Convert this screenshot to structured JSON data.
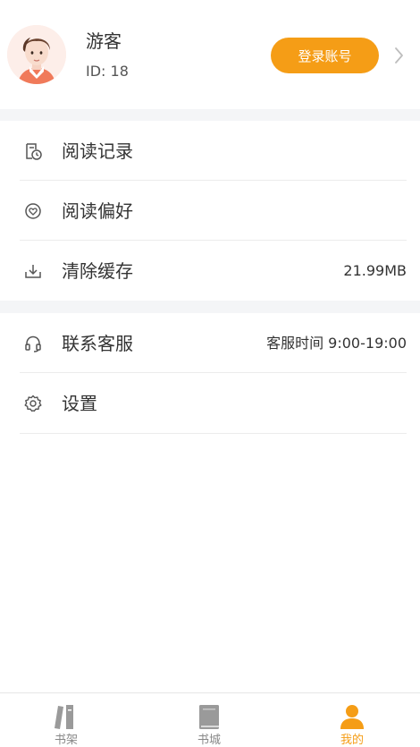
{
  "profile": {
    "username": "游客",
    "user_id": "ID: 18",
    "login_label": "登录账号"
  },
  "menu": {
    "reading_history": "阅读记录",
    "reading_preference": "阅读偏好",
    "clear_cache": "清除缓存",
    "cache_size": "21.99MB",
    "customer_service": "联系客服",
    "service_hours": "客服时间 9:00-19:00",
    "settings": "设置"
  },
  "tabs": [
    {
      "label": "书架",
      "icon": "bookshelf-icon"
    },
    {
      "label": "书城",
      "icon": "book-icon"
    },
    {
      "label": "我的",
      "icon": "person-icon"
    }
  ],
  "colors": {
    "accent": "#f59d16",
    "section_gap": "#f4f5f7",
    "icon_gray": "#555555",
    "tab_inactive": "#888888"
  }
}
